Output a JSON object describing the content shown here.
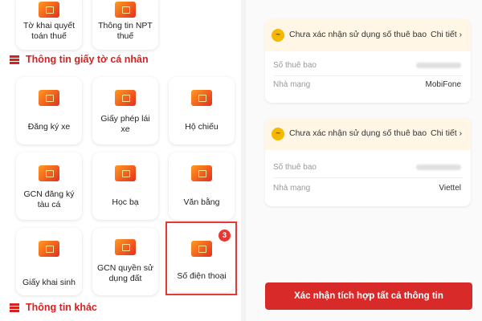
{
  "left": {
    "tax_tiles": [
      {
        "label": "Tờ khai quyết toán thuế"
      },
      {
        "label": "Thông tin NPT thuế"
      }
    ],
    "personal_section_title": "Thông tin giấy tờ cá nhân",
    "personal_tiles": [
      {
        "label": "Đăng ký xe"
      },
      {
        "label": "Giấy phép lái xe"
      },
      {
        "label": "Hộ chiếu"
      },
      {
        "label": "GCN đăng ký tàu cá"
      },
      {
        "label": "Học bạ"
      },
      {
        "label": "Văn bằng"
      },
      {
        "label": "Giấy khai sinh"
      },
      {
        "label": "GCN quyền sử dụng đất"
      },
      {
        "label": "Số điện thoại",
        "badge": "3"
      }
    ],
    "other_section_title": "Thông tin khác"
  },
  "right": {
    "cards": [
      {
        "status": "Chưa xác nhận sử dụng số thuê bao",
        "detail": "Chi tiết",
        "subscriber_label": "Số thuê bao",
        "carrier_label": "Nhà mạng",
        "carrier_value": "MobiFone"
      },
      {
        "status": "Chưa xác nhận sử dụng số thuê bao",
        "detail": "Chi tiết",
        "subscriber_label": "Số thuê bao",
        "carrier_label": "Nhà mạng",
        "carrier_value": "Viettel"
      }
    ],
    "confirm_button": "Xác nhận tích hợp tất cả thông tin"
  },
  "icons": {
    "warning": "warning-icon",
    "chevron": "chevron-right-icon",
    "tile": "document-icon",
    "section": "list-icon"
  },
  "colors": {
    "accent_red": "#d42121",
    "warning_yellow": "#f5b800",
    "warning_bg": "#fff6e5"
  }
}
